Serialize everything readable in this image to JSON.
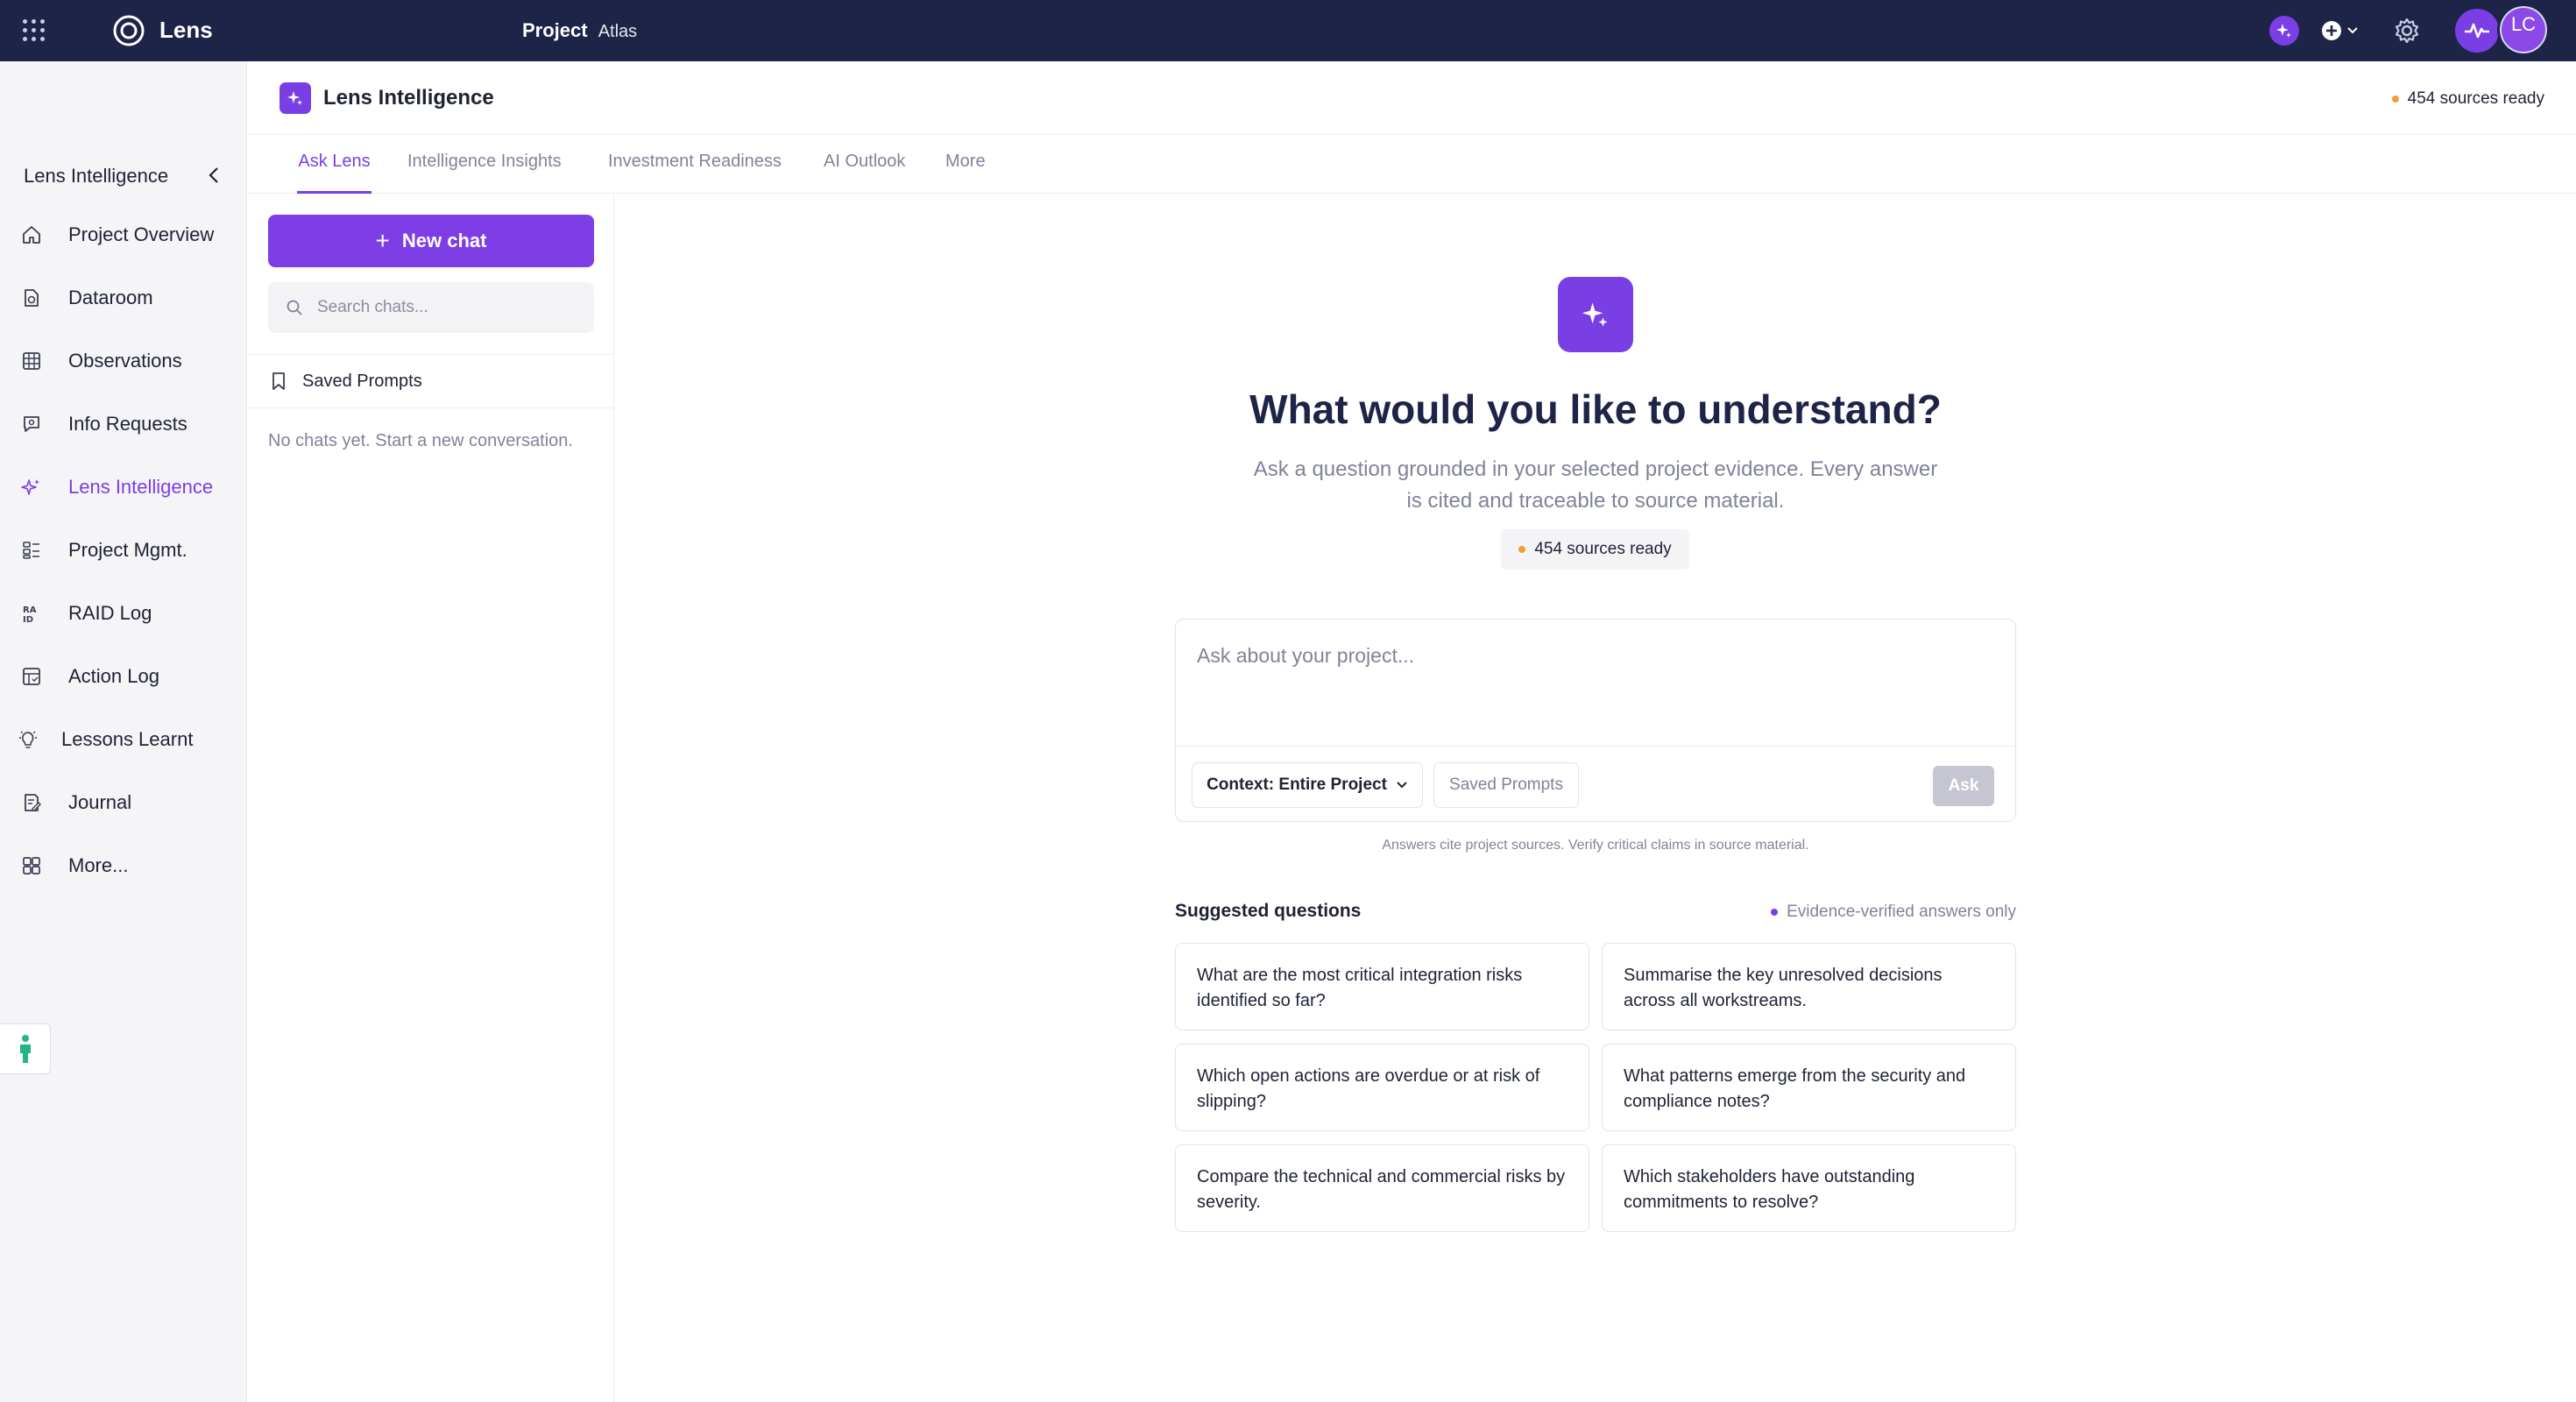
{
  "topbar": {
    "brand": "Lens",
    "project_prefix": "Project",
    "project_name": "Atlas",
    "avatar_initials": "LC"
  },
  "leftnav": {
    "header": "Lens Intelligence",
    "items": [
      {
        "label": "Project Overview",
        "icon": "home-icon"
      },
      {
        "label": "Dataroom",
        "icon": "document-icon"
      },
      {
        "label": "Observations",
        "icon": "grid-icon"
      },
      {
        "label": "Info Requests",
        "icon": "chat-search-icon"
      },
      {
        "label": "Lens Intelligence",
        "icon": "sparkle-icon",
        "active": true
      },
      {
        "label": "Project Mgmt.",
        "icon": "kanban-icon"
      },
      {
        "label": "RAID Log",
        "icon": "raid-icon"
      },
      {
        "label": "Action Log",
        "icon": "table-icon"
      },
      {
        "label": "Lessons Learnt",
        "icon": "lightbulb-icon"
      },
      {
        "label": "Journal",
        "icon": "journal-icon"
      },
      {
        "label": "More...",
        "icon": "more-grid-icon"
      }
    ]
  },
  "main": {
    "title": "Lens Intelligence",
    "sources_status": "454 sources ready",
    "tabs": [
      {
        "label": "Ask Lens",
        "active": true
      },
      {
        "label": "Intelligence Insights"
      },
      {
        "label": "Investment Readiness"
      },
      {
        "label": "AI Outlook"
      },
      {
        "label": "More"
      }
    ]
  },
  "chat_sidebar": {
    "new_chat_label": "New chat",
    "search_placeholder": "Search chats...",
    "saved_prompts_label": "Saved Prompts",
    "empty_text": "No chats yet. Start a new conversation."
  },
  "ask": {
    "heading": "What would you like to understand?",
    "subheading": "Ask a question grounded in your selected project evidence. Every answer is cited and traceable to source material.",
    "sources_pill": "454 sources ready",
    "input_placeholder": "Ask about your project...",
    "context_label": "Context: Entire Project",
    "saved_prompts_label": "Saved Prompts",
    "ask_label": "Ask",
    "disclaimer": "Answers cite project sources. Verify critical claims in source material."
  },
  "suggestions": {
    "title": "Suggested questions",
    "note": "Evidence-verified answers only",
    "questions": [
      "What are the most critical integration risks identified so far?",
      "Summarise the key unresolved decisions across all workstreams.",
      "Which open actions are overdue or at risk of slipping?",
      "What patterns emerge from the security and compliance notes?",
      "Compare the technical and commercial risks by severity.",
      "Which stakeholders have outstanding commitments to resolve?"
    ]
  },
  "colors": {
    "accent": "#7a3fe4",
    "topbar": "#1d2447",
    "status_dot": "#f0a030"
  }
}
